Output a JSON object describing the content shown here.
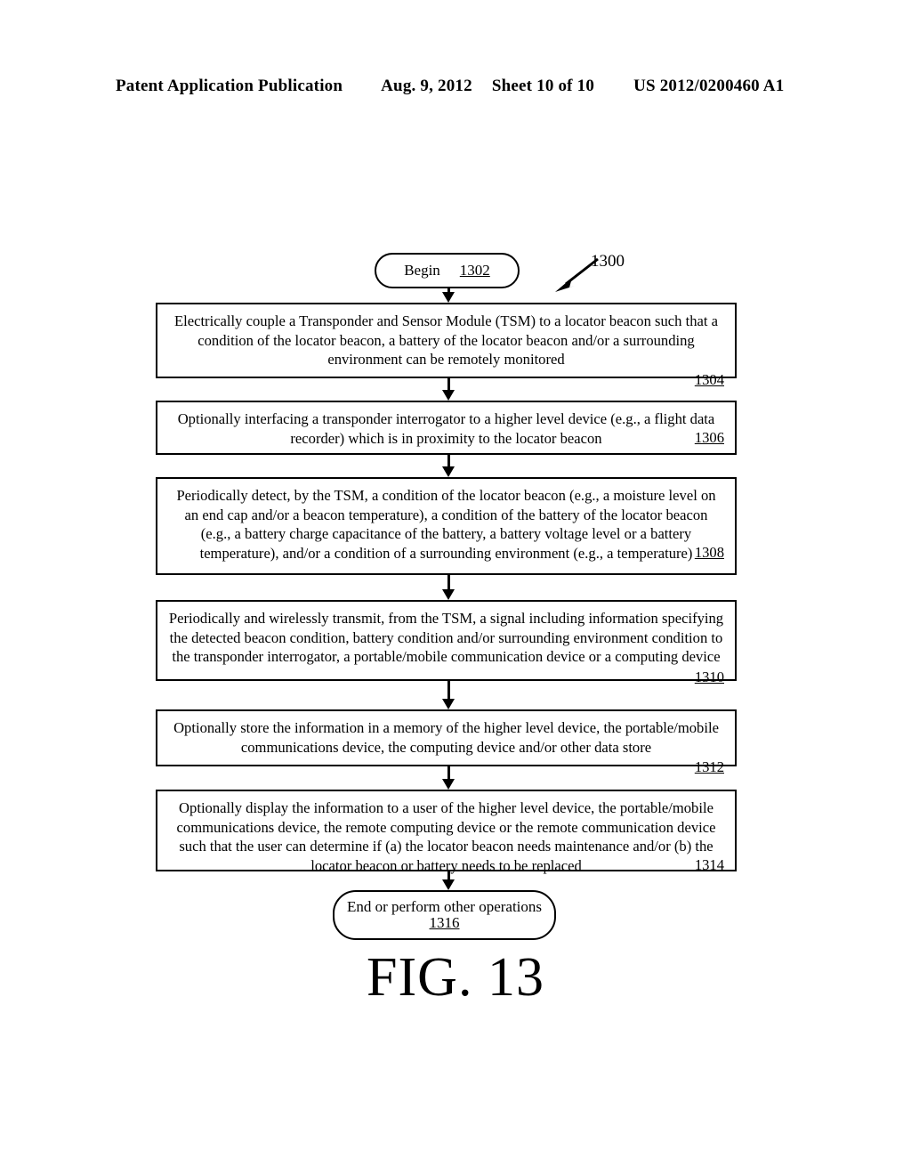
{
  "header": {
    "title": "Patent Application Publication",
    "date": "Aug. 9, 2012",
    "sheet": "Sheet 10 of 10",
    "patent_number": "US 2012/0200460 A1"
  },
  "figure": {
    "caption": "FIG. 13",
    "diagram_ref": "1300",
    "callout_icon": "diagonal-arrow-icon"
  },
  "flow": {
    "begin": {
      "label": "Begin",
      "ref": "1302"
    },
    "steps": [
      {
        "text": "Electrically couple a Transponder and Sensor Module (TSM) to a locator beacon such that a condition of the locator beacon, a battery of the locator beacon and/or a surrounding environment can be remotely monitored",
        "ref": "1304"
      },
      {
        "text": "Optionally interfacing a transponder interrogator to a higher level device (e.g., a flight data recorder) which is in proximity to the locator beacon",
        "ref": "1306"
      },
      {
        "text": "Periodically detect, by the TSM, a condition of the locator beacon (e.g., a moisture level on an end cap and/or a beacon temperature), a condition of the battery of the locator beacon (e.g., a battery charge capacitance of the battery, a battery voltage level or a battery temperature), and/or a condition of a surrounding environment (e.g., a temperature)",
        "ref": "1308"
      },
      {
        "text": "Periodically and wirelessly transmit, from the TSM, a signal including information specifying the detected beacon condition, battery condition and/or surrounding environment condition to the transponder interrogator, a portable/mobile communication device or a computing device",
        "ref": "1310"
      },
      {
        "text": "Optionally store the information in a memory of the higher level device, the portable/mobile communications device, the computing device and/or other data store",
        "ref": "1312"
      },
      {
        "text": "Optionally display the information to a user of the higher level device, the portable/mobile communications device, the remote computing device or the remote communication device such that the user can determine if (a) the locator beacon needs maintenance and/or (b) the locator beacon or battery needs to be replaced",
        "ref": "1314"
      }
    ],
    "end": {
      "label": "End or perform other operations",
      "ref": "1316"
    }
  }
}
